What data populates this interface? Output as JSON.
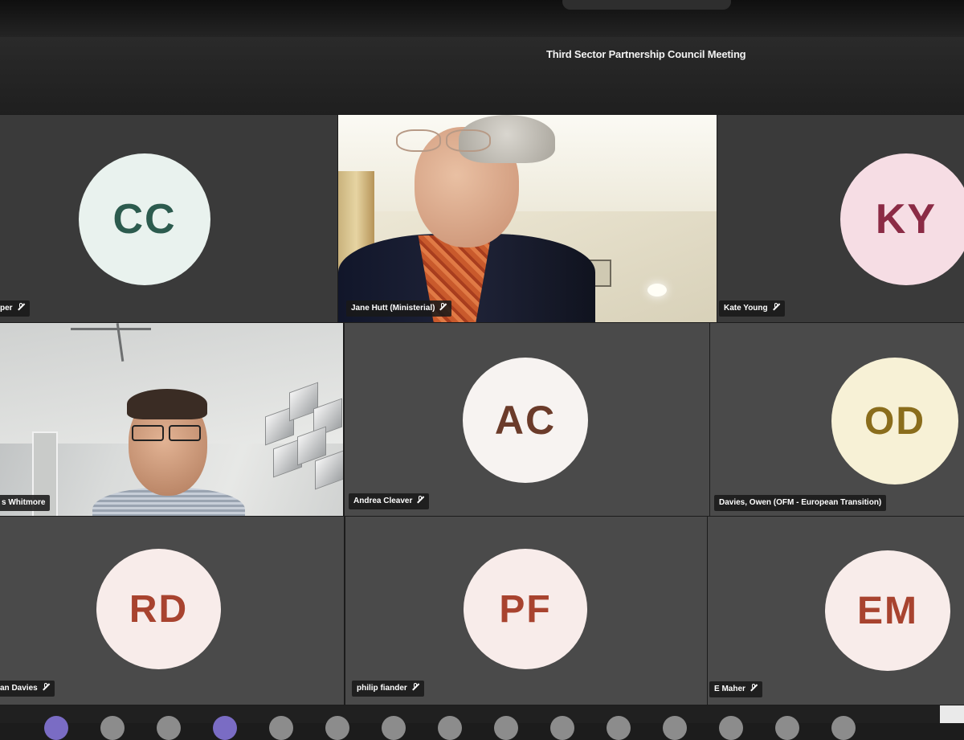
{
  "meeting": {
    "title": "Third Sector Partnership Council Meeting"
  },
  "participants": [
    {
      "initials": "CC",
      "name": "per",
      "avatar_bg": "#e9f2ee",
      "initials_color": "#2c5b4e"
    },
    {
      "initials": "",
      "name": "Jane Hutt (Ministerial)",
      "video": true
    },
    {
      "initials": "KY",
      "name": "Kate Young",
      "avatar_bg": "#f6dde4",
      "initials_color": "#8b2b45"
    },
    {
      "initials": "",
      "name": "s Whitmore",
      "video": true
    },
    {
      "initials": "AC",
      "name": "Andrea Cleaver",
      "avatar_bg": "#f7f3f1",
      "initials_color": "#6b3b2a"
    },
    {
      "initials": "OD",
      "name": "Davies, Owen (OFM - European Transition)",
      "avatar_bg": "#f7f1d6",
      "initials_color": "#8a6d1c"
    },
    {
      "initials": "RD",
      "name": "an Davies",
      "avatar_bg": "#f8ecea",
      "initials_color": "#a8432f"
    },
    {
      "initials": "PF",
      "name": "philip fiander",
      "avatar_bg": "#f8ecea",
      "initials_color": "#a8432f"
    },
    {
      "initials": "EM",
      "name": "E Maher",
      "avatar_bg": "#f8ecea",
      "initials_color": "#a8432f"
    }
  ]
}
